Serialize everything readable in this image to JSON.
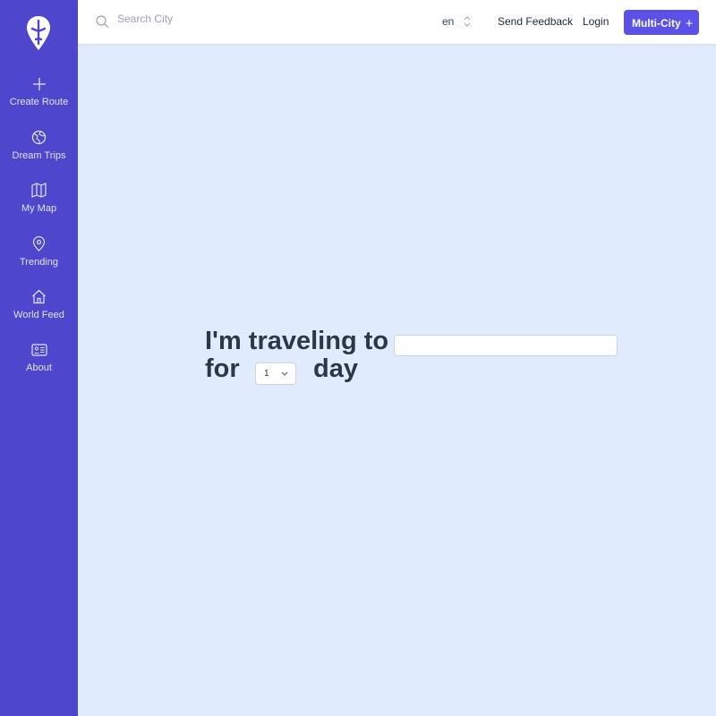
{
  "sidebar": {
    "items": [
      {
        "label": "Create Route",
        "icon": "plus-icon"
      },
      {
        "label": "Dream Trips",
        "icon": "globe-icon"
      },
      {
        "label": "My Map",
        "icon": "map-icon"
      },
      {
        "label": "Trending",
        "icon": "map-pin-icon"
      },
      {
        "label": "World Feed",
        "icon": "home-icon"
      },
      {
        "label": "About",
        "icon": "id-card-icon"
      }
    ]
  },
  "header": {
    "search_placeholder": "Search City",
    "language": "en",
    "send_feedback": "Send Feedback",
    "login": "Login",
    "multi_city": "Multi-City",
    "multi_city_icon": "+"
  },
  "main": {
    "line1": "I'm traveling to",
    "for_label": "for",
    "days_value": "1",
    "day_label": "day",
    "destination_value": ""
  },
  "colors": {
    "sidebar": "#4f46ce",
    "accent": "#5b51e8",
    "background": "#e0ecfd"
  }
}
